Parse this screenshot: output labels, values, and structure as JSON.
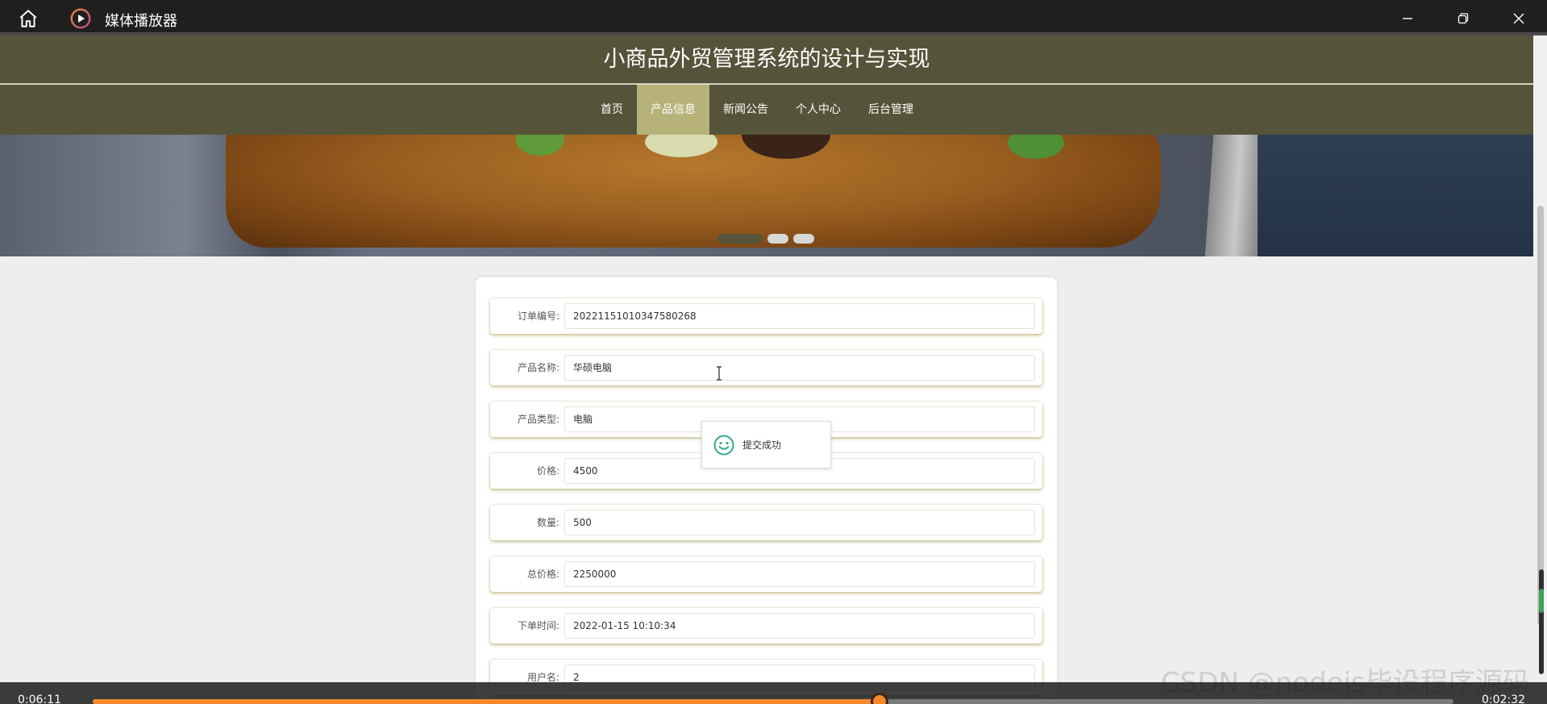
{
  "player": {
    "title": "媒体播放器",
    "time_elapsed": "0:06:11",
    "time_total": "0:02:32",
    "progress": 0.578,
    "accent_color": "#f4892c",
    "icons": [
      "home-icon",
      "play-logo-icon",
      "minimize-icon",
      "restore-icon",
      "close-icon"
    ]
  },
  "site": {
    "title": "小商品外贸管理系统的设计与实现",
    "header_color": "#55543a",
    "active_nav_color": "#b7b27a",
    "nav": [
      {
        "label": "首页"
      },
      {
        "label": "产品信息"
      },
      {
        "label": "新闻公告"
      },
      {
        "label": "个人中心"
      },
      {
        "label": "后台管理"
      }
    ],
    "active_nav_index": 1
  },
  "form": {
    "fields": [
      {
        "label": "订单编号:",
        "value": "20221151010347580268"
      },
      {
        "label": "产品名称:",
        "value": "华硕电脑"
      },
      {
        "label": "产品类型:",
        "value": "电脑"
      },
      {
        "label": "价格:",
        "value": "4500"
      },
      {
        "label": "数量:",
        "value": "500"
      },
      {
        "label": "总价格:",
        "value": "2250000"
      },
      {
        "label": "下单时间:",
        "value": "2022-01-15 10:10:34"
      },
      {
        "label": "用户名:",
        "value": "2"
      }
    ]
  },
  "toast": {
    "message": "提交成功",
    "icon": "smile-icon",
    "icon_color": "#3aaa8c"
  },
  "watermark": "CSDN @nodejs毕设程序源码"
}
